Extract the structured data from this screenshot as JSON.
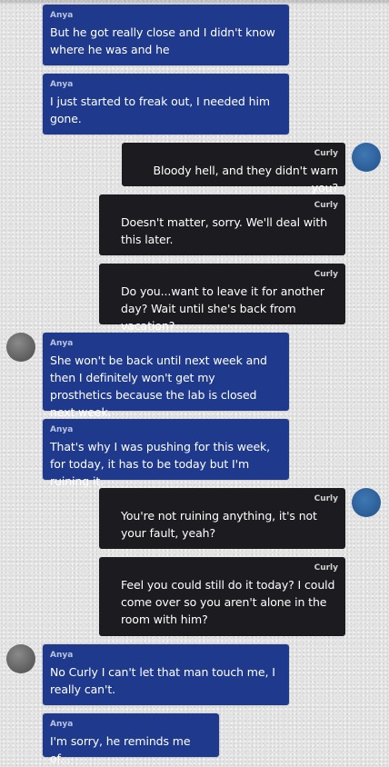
{
  "messages": [
    {
      "sender": "Anya",
      "text": "But he got really close and I didn't know where he was and he"
    },
    {
      "sender": "Anya",
      "text": "I just started to freak out, I needed him gone."
    },
    {
      "sender": "Curly",
      "text": "Bloody hell, and they didn't warn you?"
    },
    {
      "sender": "Curly",
      "text": "Doesn't matter, sorry. We'll deal with this later."
    },
    {
      "sender": "Curly",
      "text": "Do you...want to leave it for another day? Wait until she's back from vacation?"
    },
    {
      "sender": "Anya",
      "text": "She won't be back until next week and then I definitely won't get my prosthetics because the lab is closed next week."
    },
    {
      "sender": "Anya",
      "text": "That's why I was pushing for this week, for today, it has to be today but I'm ruining it."
    },
    {
      "sender": "Curly",
      "text": "You're not ruining anything, it's not your fault, yeah?"
    },
    {
      "sender": "Curly",
      "text": "Feel you could still do it today? I could come over so you aren't alone in the room with him?"
    },
    {
      "sender": "Anya",
      "text": "No Curly I can't let that man touch me, I really can't."
    },
    {
      "sender": "Anya",
      "text": "I'm sorry, he reminds me of..."
    }
  ],
  "avatars": {
    "anya": {
      "name": "anya-avatar",
      "color": "#6f6f6f"
    },
    "curly": {
      "name": "curly-avatar",
      "color": "#2d66a3"
    }
  },
  "colors": {
    "anya_bubble": "#1f3a8c",
    "curly_bubble": "#1c1c20",
    "background": "#e4e4e4"
  }
}
